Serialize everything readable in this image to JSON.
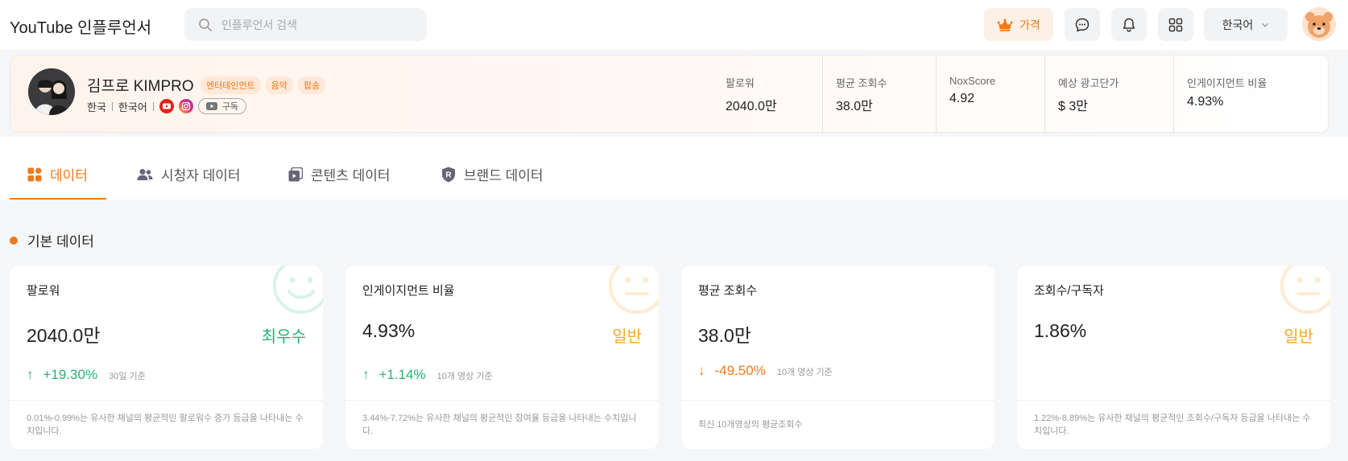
{
  "app": {
    "title": "YouTube 인플루언서"
  },
  "search": {
    "placeholder": "인플루언서 검색"
  },
  "topbar": {
    "price_label": "가격",
    "language_label": "한국어",
    "icons": [
      "chat-icon",
      "bell-icon",
      "grid-icon"
    ]
  },
  "profile": {
    "name": "김프로 KIMPRO",
    "tags": [
      "엔터테인먼트",
      "음악",
      "팝송"
    ],
    "country": "한국",
    "language": "한국어",
    "subscribe_label": "구독",
    "stats": [
      {
        "label": "팔로워",
        "value": "2040.0만"
      },
      {
        "label": "평균 조회수",
        "value": "38.0만"
      },
      {
        "label": "NoxScore",
        "value": "4.92"
      },
      {
        "label": "예상 광고단가",
        "value": "$ 3만"
      },
      {
        "label": "인게이지먼트 비율",
        "value": "4.93%"
      }
    ]
  },
  "tabs": [
    {
      "label": "데이터",
      "active": true
    },
    {
      "label": "시청자 데이터",
      "active": false
    },
    {
      "label": "콘텐츠 데이터",
      "active": false
    },
    {
      "label": "브랜드 데이터",
      "active": false
    }
  ],
  "section": {
    "title": "기본 데이터"
  },
  "cards": [
    {
      "title": "팔로워",
      "value": "2040.0만",
      "grade": "최우수",
      "grade_color": "#22b573",
      "change": "+19.30%",
      "direction": "up",
      "basis": "30일 기준",
      "description": "0.01%-0.99%는 유사한 채널의 평균적인 팔로워수 증가 등급을 나타내는 수치입니다."
    },
    {
      "title": "인게이지먼트 비율",
      "value": "4.93%",
      "grade": "일반",
      "grade_color": "#f5a623",
      "change": "+1.14%",
      "direction": "up",
      "basis": "10개 영상 기준",
      "description": "3.44%-7.72%는 유사한 채널의 평균적인 참여율 등급을 나타내는 수치입니다."
    },
    {
      "title": "평균 조회수",
      "value": "38.0만",
      "grade": "",
      "change": "-49.50%",
      "direction": "down",
      "basis": "10개 영상 기준",
      "description": "최신 10개영상의 평균조회수"
    },
    {
      "title": "조회수/구독자",
      "value": "1.86%",
      "grade": "일반",
      "grade_color": "#f5a623",
      "change": "",
      "direction": "",
      "basis": "",
      "description": "1.22%-8.89%는 유사한 채널의 평균적인 조회수/구독자 등급을 나타내는 수치입니다."
    }
  ],
  "colors": {
    "accent": "#f07a1c",
    "positive": "#22b573",
    "normal": "#f5a623"
  }
}
